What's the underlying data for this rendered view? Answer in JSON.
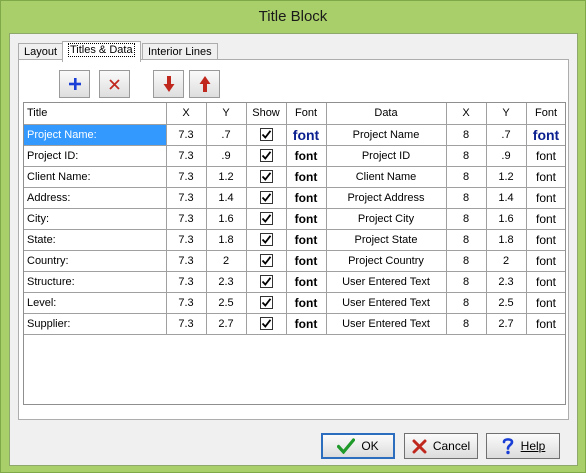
{
  "window": {
    "title": "Title Block"
  },
  "tabs": [
    {
      "label": "Layout",
      "active": false
    },
    {
      "label": "Titles & Data",
      "active": true
    },
    {
      "label": "Interior Lines",
      "active": false
    }
  ],
  "toolbar": {
    "add_icon": "plus-icon",
    "delete_icon": "x-icon",
    "move_down_icon": "arrow-down-icon",
    "move_up_icon": "arrow-up-icon",
    "colors": {
      "add": "#1a3fd6",
      "delete": "#c0281e",
      "arrows": "#c0281e"
    }
  },
  "grid": {
    "headers": [
      "Title",
      "X",
      "Y",
      "Show",
      "Font",
      "Data",
      "X",
      "Y",
      "Font"
    ],
    "rows": [
      {
        "title": "Project Name:",
        "x": "7.3",
        "y": ".7",
        "show": true,
        "font": "font",
        "data": "Project Name",
        "x2": "8",
        "y2": ".7",
        "font2": "font"
      },
      {
        "title": "Project ID:",
        "x": "7.3",
        "y": ".9",
        "show": true,
        "font": "font",
        "data": "Project ID",
        "x2": "8",
        "y2": ".9",
        "font2": "font"
      },
      {
        "title": "Client Name:",
        "x": "7.3",
        "y": "1.2",
        "show": true,
        "font": "font",
        "data": "Client Name",
        "x2": "8",
        "y2": "1.2",
        "font2": "font"
      },
      {
        "title": "Address:",
        "x": "7.3",
        "y": "1.4",
        "show": true,
        "font": "font",
        "data": "Project Address",
        "x2": "8",
        "y2": "1.4",
        "font2": "font"
      },
      {
        "title": "City:",
        "x": "7.3",
        "y": "1.6",
        "show": true,
        "font": "font",
        "data": "Project City",
        "x2": "8",
        "y2": "1.6",
        "font2": "font"
      },
      {
        "title": "State:",
        "x": "7.3",
        "y": "1.8",
        "show": true,
        "font": "font",
        "data": "Project State",
        "x2": "8",
        "y2": "1.8",
        "font2": "font"
      },
      {
        "title": "Country:",
        "x": "7.3",
        "y": "2",
        "show": true,
        "font": "font",
        "data": "Project Country",
        "x2": "8",
        "y2": "2",
        "font2": "font"
      },
      {
        "title": "Structure:",
        "x": "7.3",
        "y": "2.3",
        "show": true,
        "font": "font",
        "data": "User Entered Text",
        "x2": "8",
        "y2": "2.3",
        "font2": "font"
      },
      {
        "title": "Level:",
        "x": "7.3",
        "y": "2.5",
        "show": true,
        "font": "font",
        "data": "User Entered Text",
        "x2": "8",
        "y2": "2.5",
        "font2": "font"
      },
      {
        "title": "Supplier:",
        "x": "7.3",
        "y": "2.7",
        "show": true,
        "font": "font",
        "data": "User Entered Text",
        "x2": "8",
        "y2": "2.7",
        "font2": "font"
      }
    ],
    "selected_row": 0
  },
  "buttons": {
    "ok": "OK",
    "cancel": "Cancel",
    "help": "Help",
    "ok_icon": "checkmark-icon",
    "cancel_icon": "x-icon",
    "help_icon": "question-icon"
  }
}
